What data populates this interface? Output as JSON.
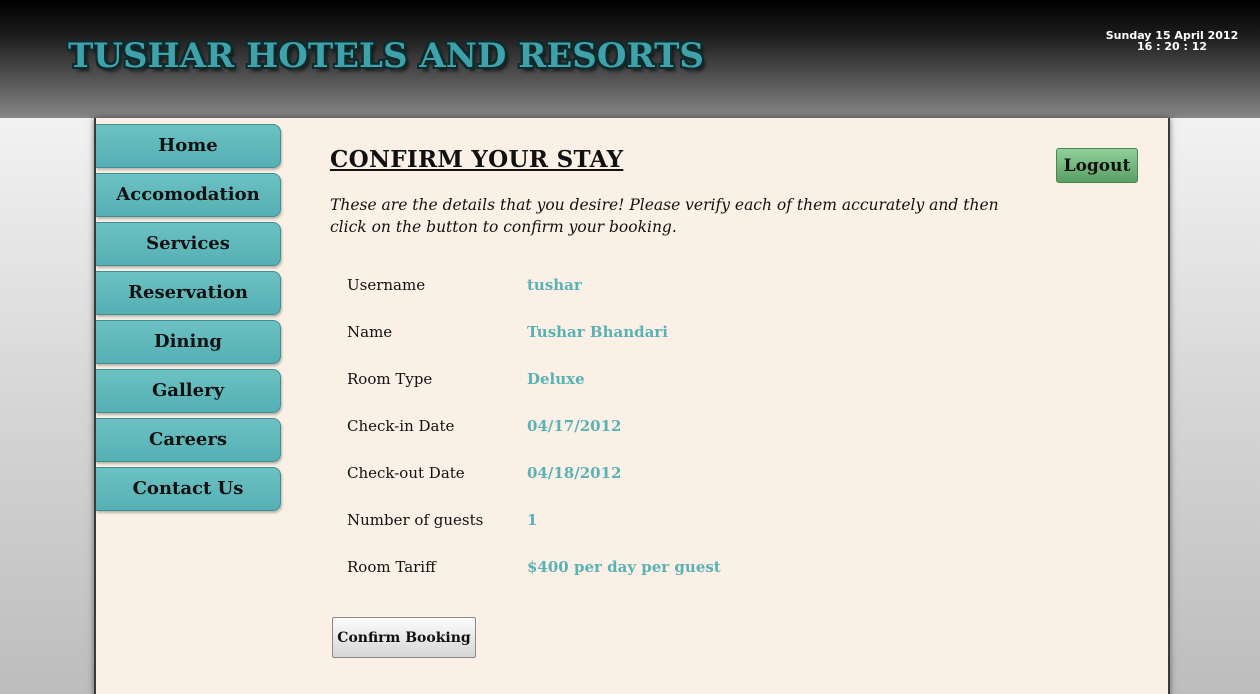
{
  "header": {
    "title": "TUSHAR HOTELS AND RESORTS",
    "date": "Sunday 15 April 2012",
    "time": "16 : 20 : 12"
  },
  "nav": {
    "items": [
      {
        "label": "Home"
      },
      {
        "label": "Accomodation"
      },
      {
        "label": "Services"
      },
      {
        "label": "Reservation"
      },
      {
        "label": "Dining"
      },
      {
        "label": "Gallery"
      },
      {
        "label": "Careers"
      },
      {
        "label": "Contact Us"
      }
    ]
  },
  "main": {
    "heading": "CONFIRM YOUR STAY",
    "logout_label": "Logout",
    "intro": "These are the details that you desire! Please verify each of them accurately and then click on the button to confirm your booking.",
    "details": [
      {
        "label": "Username",
        "value": "tushar"
      },
      {
        "label": "Name",
        "value": "Tushar Bhandari"
      },
      {
        "label": "Room Type",
        "value": "Deluxe"
      },
      {
        "label": "Check-in Date",
        "value": "04/17/2012"
      },
      {
        "label": "Check-out Date",
        "value": "04/18/2012"
      },
      {
        "label": "Number of guests",
        "value": "1"
      },
      {
        "label": "Room Tariff",
        "value": "$400 per day per guest"
      }
    ],
    "confirm_label": "Confirm Booking"
  },
  "colors": {
    "nav_teal": "#5ab2b5",
    "value_teal": "#5ab2b5",
    "panel_bg": "#faf0e6",
    "logout_green": "#6fb57a"
  }
}
